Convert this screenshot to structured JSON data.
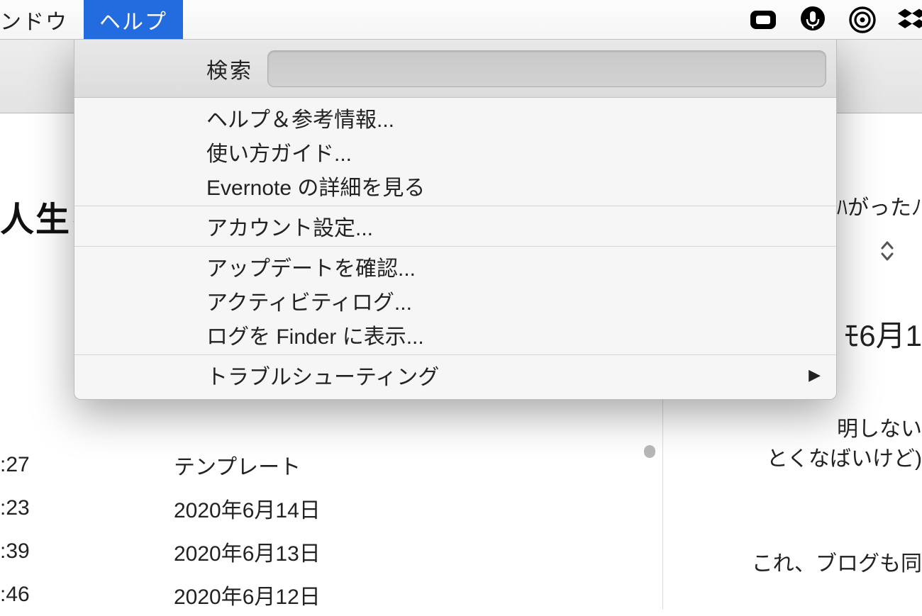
{
  "menubar": {
    "items": [
      {
        "label": "ンドウ"
      },
      {
        "label": "ヘルプ"
      }
    ],
    "active_index": 1
  },
  "help_menu": {
    "search_label": "検索",
    "search_value": "",
    "groups": [
      {
        "items": [
          {
            "label": "ヘルプ＆参考情報..."
          },
          {
            "label": "使い方ガイド..."
          },
          {
            "label": "Evernote の詳細を見る"
          }
        ]
      },
      {
        "items": [
          {
            "label": "アカウント設定..."
          }
        ]
      },
      {
        "items": [
          {
            "label": "アップデートを確認..."
          },
          {
            "label": "アクティビティログ..."
          },
          {
            "label": "ログを Finder に表示..."
          }
        ]
      },
      {
        "items": [
          {
            "label": "トラブルシューティング",
            "has_submenu": true
          }
        ]
      }
    ]
  },
  "status_icons": [
    "video-icon",
    "mic-icon",
    "target-icon",
    "dropbox-icon"
  ],
  "background": {
    "left_title_fragment": "人生を",
    "list_rows": [
      {
        "time_fragment": ":27",
        "label": "テンプレート"
      },
      {
        "time_fragment": ":23",
        "label": "2020年6月14日"
      },
      {
        "time_fragment": ":39",
        "label": "2020年6月13日"
      },
      {
        "time_fragment": ":46",
        "label": "2020年6月12日"
      }
    ],
    "right_header_fragment": "ﾊがったﾉ",
    "right_date_fragment": "ﾓ6月1",
    "right_body_line1": "明しない",
    "right_body_line2": "とくなばいけど)",
    "right_body_line3": "これ、ブログも同"
  }
}
